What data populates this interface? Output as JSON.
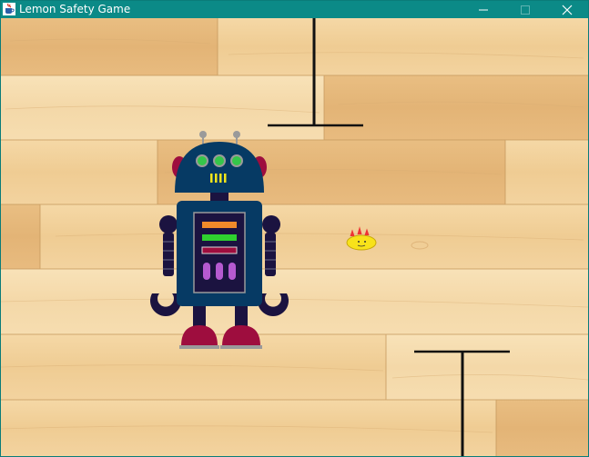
{
  "window": {
    "title": "Lemon Safety Game",
    "title_icon": "java-cup-icon",
    "controls": [
      "minimize-icon",
      "maximize-icon",
      "close-icon"
    ]
  },
  "game": {
    "sprites": [
      "robot",
      "lemon",
      "t-barrier-top",
      "t-barrier-bottom"
    ],
    "colors": {
      "robot_body": "#063a64",
      "robot_dark": "#1b1340",
      "robot_accent": "#9e0d3e",
      "robot_eyes": "#35c64a",
      "lemon": "#f8e21a",
      "barrier": "#111111"
    }
  }
}
